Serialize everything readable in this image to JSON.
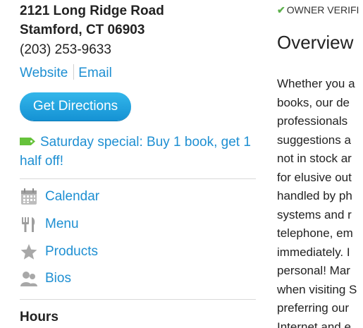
{
  "business": {
    "address_line1": "2121 Long Ridge Road",
    "address_line2": "Stamford, CT 06903",
    "phone": "(203) 253-9633"
  },
  "links": {
    "website": "Website",
    "email": "Email"
  },
  "directions_button": "Get Directions",
  "special": "Saturday special: Buy 1 book, get 1 half off!",
  "nav": [
    {
      "label": "Calendar",
      "icon": "calendar-icon"
    },
    {
      "label": "Menu",
      "icon": "fork-knife-icon"
    },
    {
      "label": "Products",
      "icon": "star-icon"
    },
    {
      "label": "Bios",
      "icon": "people-icon"
    }
  ],
  "hours_heading": "Hours",
  "verified": "OWNER VERIFI",
  "overview_heading": "Overview",
  "overview_lines": [
    "Whether you a",
    "books, our de",
    "professionals",
    "suggestions a",
    "not in stock ar",
    "for elusive out",
    "handled by ph",
    "systems and r",
    "telephone, em",
    "immediately. I",
    "personal! Mar",
    "when visiting S",
    "preferring our",
    "Internet and e"
  ],
  "colors": {
    "link": "#1e8fd2",
    "button": "#1f9fdc",
    "tag": "#66c23b",
    "check": "#5cb04b"
  }
}
